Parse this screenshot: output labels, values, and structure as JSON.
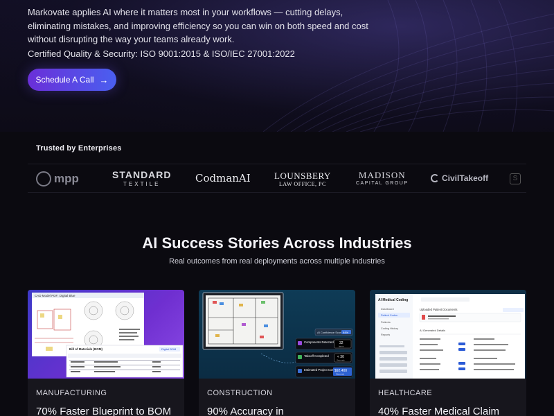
{
  "hero": {
    "description": "Markovate applies AI where it matters most in your workflows — cutting delays, eliminating mistakes, and improving efficiency so you can win on both speed and cost without disrupting the way your teams already work.",
    "certification": "Certified Quality & Security: ISO 9001:2015 & ISO/IEC 27001:2022",
    "cta_label": "Schedule A Call",
    "cta_icon": "arrow-right-icon"
  },
  "trusted": {
    "title": "Trusted by Enterprises",
    "logos": {
      "mpp": "mpp",
      "standard_main": "STANDARD",
      "standard_sub": "TEXTILE",
      "codman": "CodmanAI",
      "lounsbery_main": "LOUNSBERY",
      "lounsbery_sub": "LAW OFFICE, PC",
      "madison_main": "MADISON",
      "madison_sub": "CAPITAL GROUP",
      "civil": "CivilTakeoff"
    }
  },
  "stories": {
    "title": "AI Success Stories Across Industries",
    "subtitle": "Real outcomes from real deployments across multiple industries",
    "cards": [
      {
        "industry": "MANUFACTURING",
        "headline": "70% Faster Blueprint to BOM",
        "thumb": {
          "doc_title": "CAD Model PDF: Digital Blue",
          "table_title": "Bill of Materials (BOM)",
          "badge": "Digital BOM"
        }
      },
      {
        "industry": "CONSTRUCTION",
        "headline": "90% Accuracy in",
        "thumb": {
          "score_label": "AI Confidence Score",
          "score_value": "94%",
          "rows": [
            {
              "label": "Components Detected",
              "value": "32",
              "unit": "Items"
            },
            {
              "label": "Takeoff Completed",
              "value": "< 30",
              "unit": "Seconds"
            },
            {
              "label": "Estimated Project Cost",
              "value": "$92,400",
              "unit": "Materials"
            }
          ]
        }
      },
      {
        "industry": "HEALTHCARE",
        "headline": "40% Faster Medical Claim",
        "thumb": {
          "app_title": "AI Medical Coding",
          "section": "Uploaded Patient Documents",
          "codes_label": "AI Generated Details",
          "nav": [
            "Dashboard",
            "Patient Codes",
            "Patients",
            "Coding History",
            "Reports"
          ]
        }
      }
    ]
  },
  "colors": {
    "accent_start": "#6a2fd8",
    "accent_end": "#4a5ff0",
    "background": "#0b0a10"
  }
}
